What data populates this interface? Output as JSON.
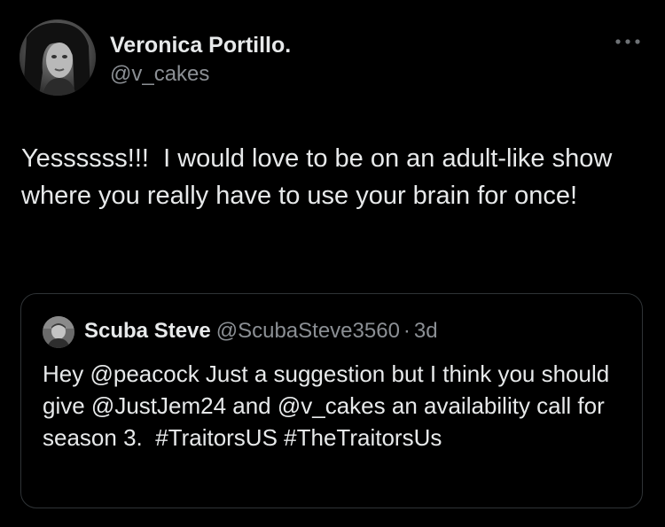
{
  "tweet": {
    "author": {
      "display_name": "Veronica Portillo.",
      "handle": "@v_cakes"
    },
    "more_icon": "more-horizontal-icon",
    "text": "Yessssss!!!  I would love to be on an adult-like show where you really have to use your brain for once!"
  },
  "quoted_tweet": {
    "author": {
      "display_name": "Scuba Steve",
      "handle": "@ScubaSteve3560"
    },
    "separator": "·",
    "time": "3d",
    "text": "Hey @peacock Just a suggestion but I think you should give @JustJem24 and @v_cakes an availability call for season 3.  #TraitorsUS #TheTraitorsUs"
  },
  "colors": {
    "background": "#000000",
    "text_primary": "#e7e9ea",
    "text_secondary": "#8b8f94",
    "border": "#2f3336"
  }
}
